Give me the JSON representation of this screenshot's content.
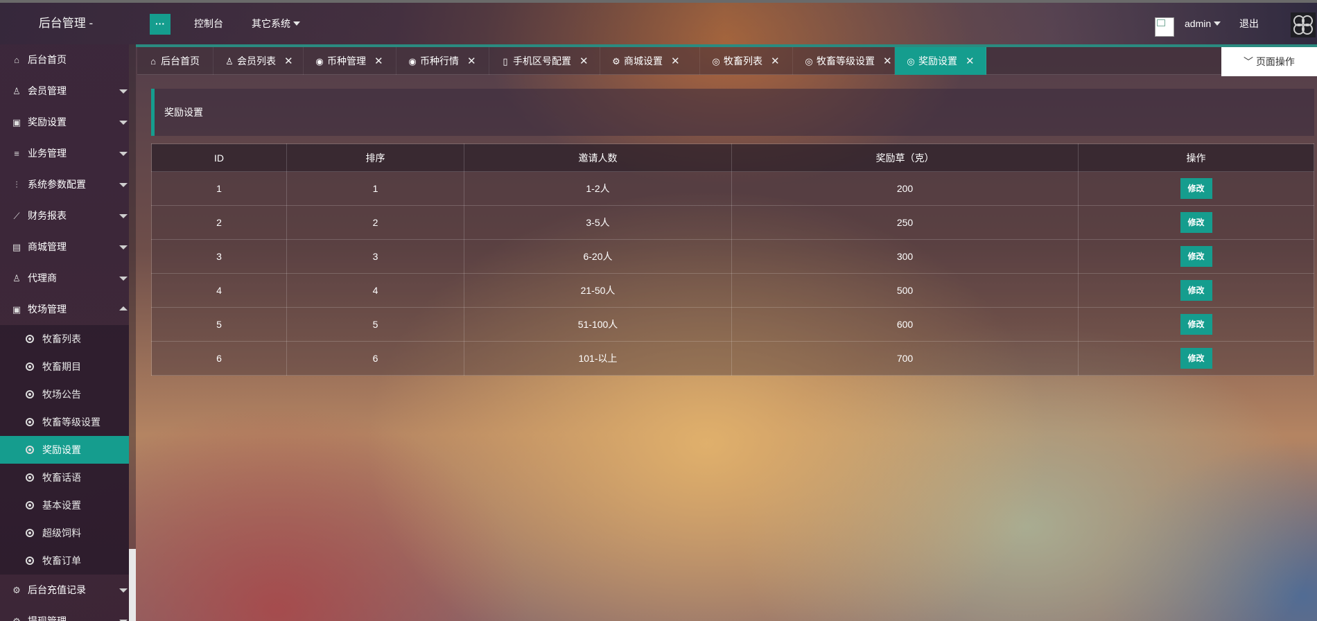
{
  "header": {
    "brand": "后台管理 -",
    "menu_toggle": "···",
    "nav": [
      "控制台",
      "其它系统"
    ],
    "user": "admin",
    "logout": "退出"
  },
  "sidebar": {
    "items": [
      {
        "label": "后台首页",
        "icon": "home-icon",
        "glyph": "⌂",
        "arrow": ""
      },
      {
        "label": "会员管理",
        "icon": "user-icon",
        "glyph": "♙",
        "arrow": "down"
      },
      {
        "label": "奖励设置",
        "icon": "gift-icon",
        "glyph": "▣",
        "arrow": "down"
      },
      {
        "label": "业务管理",
        "icon": "list-icon",
        "glyph": "≡",
        "arrow": "down"
      },
      {
        "label": "系统参数配置",
        "icon": "sliders-icon",
        "glyph": "⫶",
        "arrow": "down"
      },
      {
        "label": "财务报表",
        "icon": "chart-icon",
        "glyph": "⟋",
        "arrow": "down"
      },
      {
        "label": "商城管理",
        "icon": "shop-icon",
        "glyph": "▤",
        "arrow": "down"
      },
      {
        "label": "代理商",
        "icon": "agent-icon",
        "glyph": "♙",
        "arrow": "down"
      },
      {
        "label": "牧场管理",
        "icon": "gift-icon",
        "glyph": "▣",
        "arrow": "up"
      }
    ],
    "sub_items": [
      "牧畜列表",
      "牧畜期目",
      "牧场公告",
      "牧畜等级设置",
      "奖励设置",
      "牧畜话语",
      "基本设置",
      "超级饲料",
      "牧畜订单"
    ],
    "active_sub": 4,
    "bottom_items": [
      {
        "label": "后台充值记录",
        "icon": "gear-icon",
        "glyph": "⚙"
      },
      {
        "label": "提现管理",
        "icon": "gear-icon",
        "glyph": "⚙"
      }
    ]
  },
  "tabs": [
    {
      "label": "后台首页",
      "icon": "home-icon",
      "glyph": "⌂",
      "closable": false
    },
    {
      "label": "会员列表",
      "icon": "user-icon",
      "glyph": "♙",
      "closable": true
    },
    {
      "label": "币种管理",
      "icon": "coin-icon",
      "glyph": "◉",
      "closable": true
    },
    {
      "label": "币种行情",
      "icon": "coin-icon",
      "glyph": "◉",
      "closable": true
    },
    {
      "label": "手机区号配置",
      "icon": "phone-icon",
      "glyph": "▯",
      "closable": true
    },
    {
      "label": "商城设置",
      "icon": "gear-icon",
      "glyph": "⚙",
      "closable": true
    },
    {
      "label": "牧畜列表",
      "icon": "circle-icon",
      "glyph": "◎",
      "closable": true
    },
    {
      "label": "牧畜等级设置",
      "icon": "circle-icon",
      "glyph": "◎",
      "closable": true
    },
    {
      "label": "奖励设置",
      "icon": "circle-icon",
      "glyph": "◎",
      "closable": true
    }
  ],
  "active_tab": 8,
  "page_op": "页面操作",
  "panel_title": "奖励设置",
  "table": {
    "columns": [
      "ID",
      "排序",
      "邀请人数",
      "奖励草（克）",
      "操作"
    ],
    "rows": [
      [
        "1",
        "1",
        "1-2人",
        "200"
      ],
      [
        "2",
        "2",
        "3-5人",
        "250"
      ],
      [
        "3",
        "3",
        "6-20人",
        "300"
      ],
      [
        "4",
        "4",
        "21-50人",
        "500"
      ],
      [
        "5",
        "5",
        "51-100人",
        "600"
      ],
      [
        "6",
        "6",
        "101-以上",
        "700"
      ]
    ],
    "edit_label": "修改"
  },
  "colors": {
    "accent": "#159d8e"
  }
}
